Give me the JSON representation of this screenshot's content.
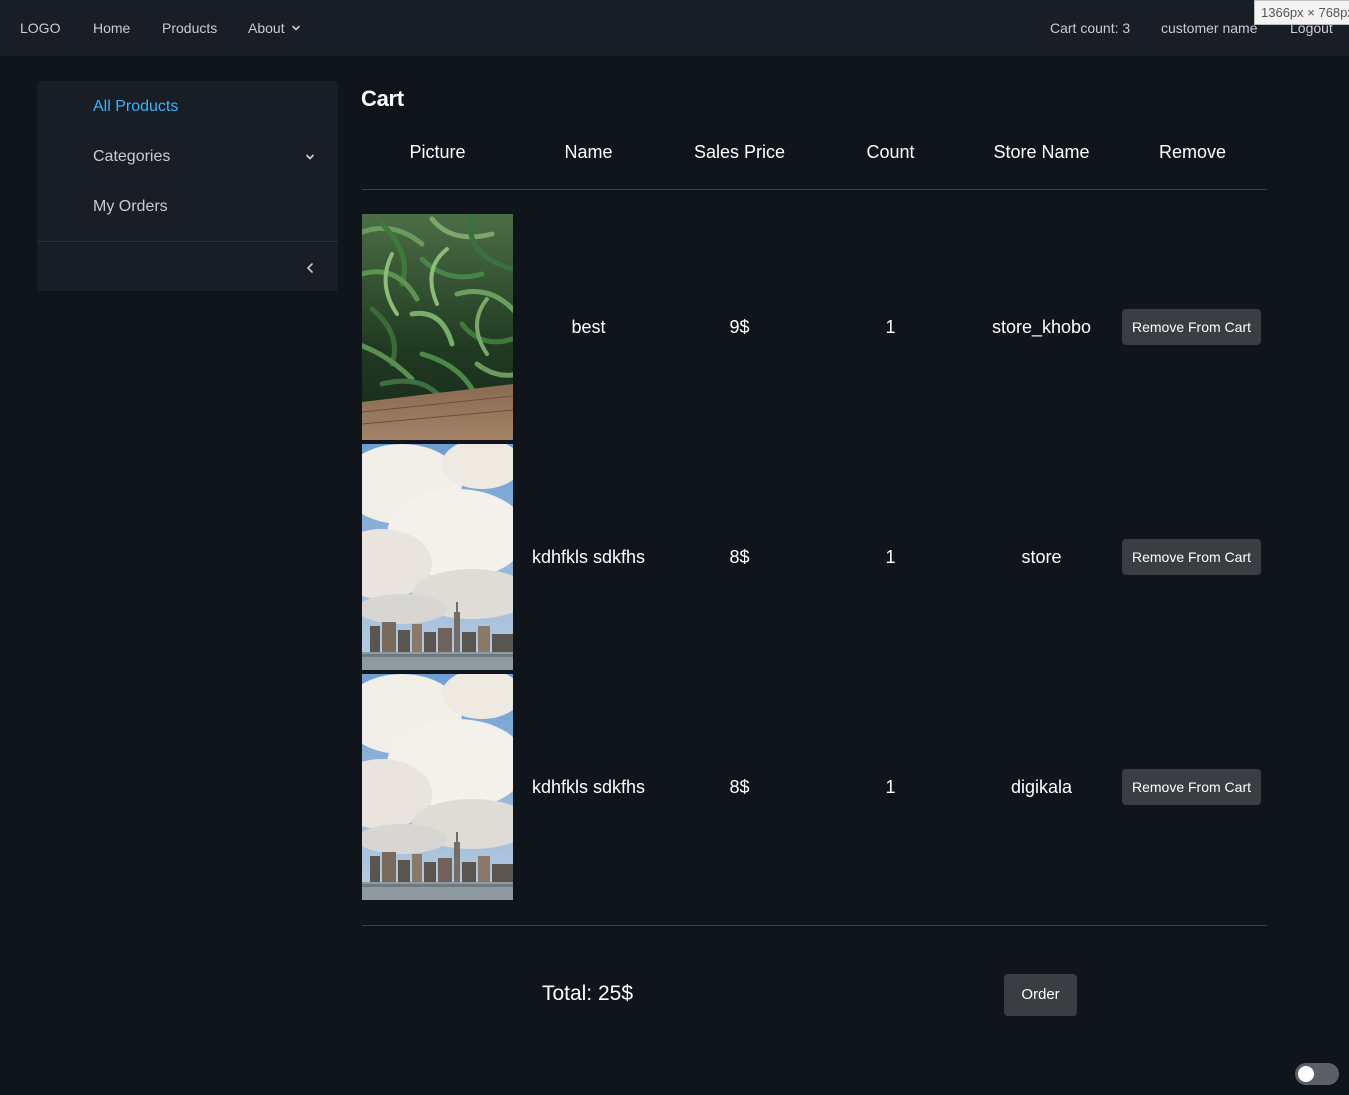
{
  "nav": {
    "logo": "LOGO",
    "home": "Home",
    "products": "Products",
    "about": "About",
    "cart_count": "Cart count: 3",
    "customer": "customer name",
    "logout": "Logout"
  },
  "viewport_tag": "1366px × 768px",
  "sidebar": {
    "items": [
      {
        "label": "All Products",
        "active": true
      },
      {
        "label": "Categories"
      },
      {
        "label": "My Orders"
      }
    ]
  },
  "cart": {
    "title": "Cart",
    "columns": [
      "Picture",
      "Name",
      "Sales Price",
      "Count",
      "Store Name",
      "Remove"
    ],
    "rows": [
      {
        "picture": "green beans",
        "name": "best",
        "price": "9$",
        "count": "1",
        "store": "store_khobo",
        "remove": "Remove From Cart"
      },
      {
        "picture": "city skyline",
        "name": "kdhfkls sdkfhs",
        "price": "8$",
        "count": "1",
        "store": "store",
        "remove": "Remove From Cart"
      },
      {
        "picture": "city skyline",
        "name": "kdhfkls sdkfhs",
        "price": "8$",
        "count": "1",
        "store": "digikala",
        "remove": "Remove From Cart"
      }
    ],
    "total": "Total: 25$",
    "order_button": "Order"
  },
  "theme_toggle": {
    "on": false
  },
  "colors": {
    "accent": "#3ab3ff",
    "background": "#10141b",
    "navbar": "#191d25",
    "button": "#3a3d42"
  }
}
